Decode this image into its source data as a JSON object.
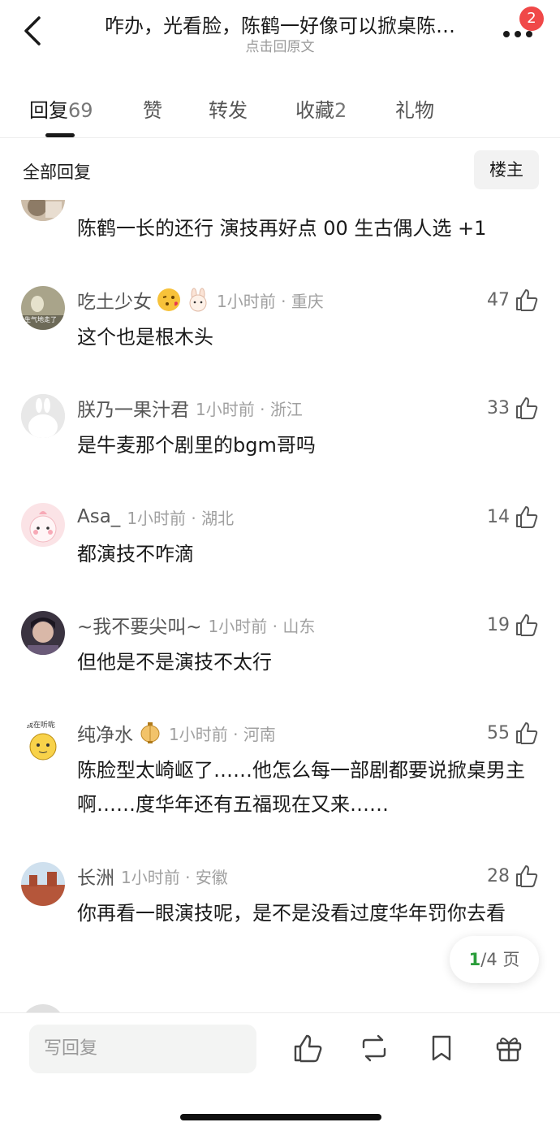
{
  "header": {
    "title": "咋办，光看脸，陈鹤一好像可以掀桌陈…",
    "subtitle": "点击回原文",
    "badge_count": "2",
    "back_icon": "chevron-left-icon",
    "more_icon": "more-dots-icon"
  },
  "tabs": [
    {
      "label": "回复",
      "count": "69",
      "active": true
    },
    {
      "label": "赞",
      "count": "",
      "active": false
    },
    {
      "label": "转发",
      "count": "",
      "active": false
    },
    {
      "label": "收藏",
      "count": "2",
      "active": false
    },
    {
      "label": "礼物",
      "count": "",
      "active": false
    }
  ],
  "filter": {
    "label": "全部回复",
    "owner_button": "楼主"
  },
  "comments": [
    {
      "name": "",
      "time": "",
      "location": "",
      "likes": "",
      "text": "陈鹤一长的还行 演技再好点 00 生古偶人选 +1"
    },
    {
      "name": "吃土少女",
      "emojis": [
        "kiss-face-icon",
        "rabbit-icon"
      ],
      "time": "1小时前",
      "location": "重庆",
      "likes": "47",
      "text": "这个也是根木头"
    },
    {
      "name": "朕乃一果汁君",
      "time": "1小时前",
      "location": "浙江",
      "likes": "33",
      "text": "是牛麦那个剧里的bgm哥吗"
    },
    {
      "name": "Asa_",
      "time": "1小时前",
      "location": "湖北",
      "likes": "14",
      "text": "都演技不咋滴"
    },
    {
      "name": "~我不要尖叫~",
      "time": "1小时前",
      "location": "山东",
      "likes": "19",
      "text": "但他是不是演技不太行"
    },
    {
      "name": "纯净水",
      "emojis": [
        "lantern-icon"
      ],
      "time": "1小时前",
      "location": "河南",
      "likes": "55",
      "text": "陈脸型太崎岖了……他怎么每一部剧都要说掀桌男主啊……度华年还有五福现在又来……"
    },
    {
      "name": "长洲",
      "time": "1小时前",
      "location": "安徽",
      "likes": "28",
      "text": "你再看一眼演技呢，是不是没看过度华年罚你去看"
    }
  ],
  "avatar_texts": {
    "c1": "生气地走了",
    "c6": "我在听呢"
  },
  "pager": {
    "current": "1",
    "rest": "/4 页"
  },
  "bottombar": {
    "placeholder": "写回复",
    "icons": [
      "like-icon",
      "repost-icon",
      "bookmark-icon",
      "gift-icon"
    ]
  },
  "colors": {
    "accent_green": "#2a9d3a",
    "badge_red": "#f04848",
    "muted_text": "#a0a0a0"
  }
}
